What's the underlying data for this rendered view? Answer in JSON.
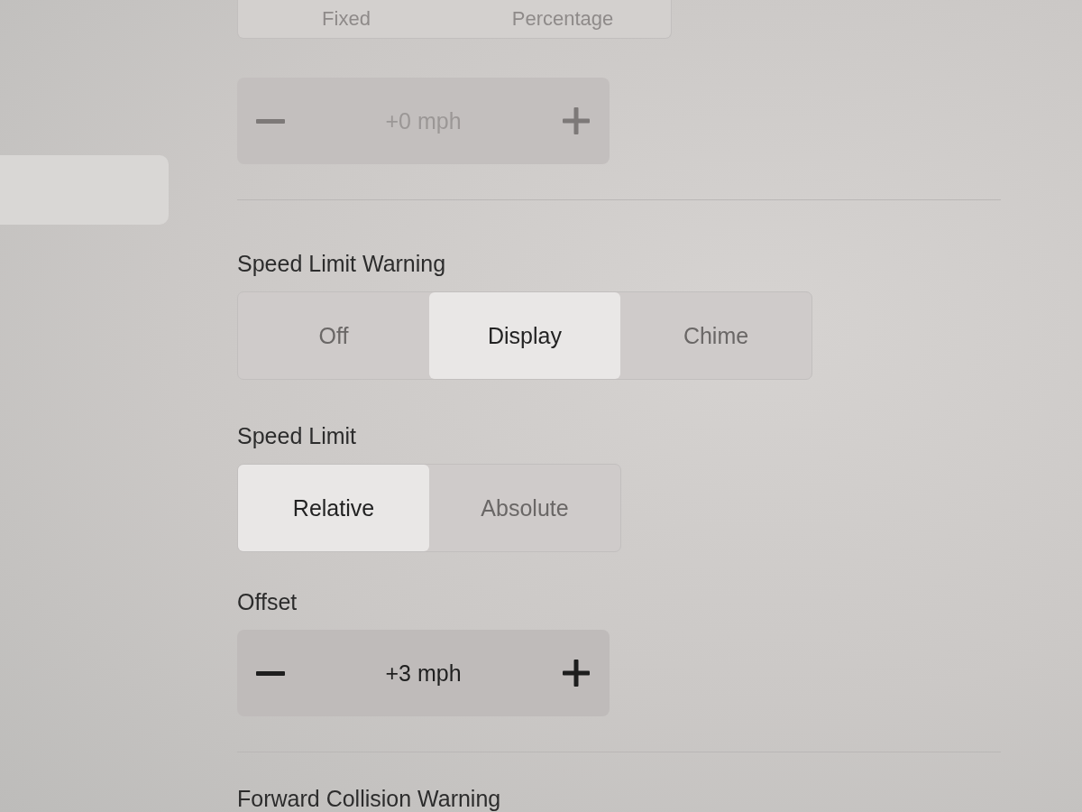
{
  "sidebar": {
    "items": [
      {
        "selected": true
      }
    ]
  },
  "section_1": {
    "mode_options": {
      "disabled": true,
      "options": [
        {
          "label": "Fixed",
          "selected": false
        },
        {
          "label": "Percentage",
          "selected": false
        }
      ]
    },
    "stepper": {
      "value": "+0 mph",
      "disabled": true
    }
  },
  "speed_limit_warning": {
    "label": "Speed Limit Warning",
    "options": [
      {
        "label": "Off",
        "selected": false
      },
      {
        "label": "Display",
        "selected": true
      },
      {
        "label": "Chime",
        "selected": false
      }
    ]
  },
  "speed_limit": {
    "label": "Speed Limit",
    "options": [
      {
        "label": "Relative",
        "selected": true
      },
      {
        "label": "Absolute",
        "selected": false
      }
    ]
  },
  "offset": {
    "label": "Offset",
    "stepper": {
      "value": "+3 mph",
      "disabled": false
    }
  },
  "forward_collision_warning": {
    "label": "Forward Collision Warning"
  }
}
